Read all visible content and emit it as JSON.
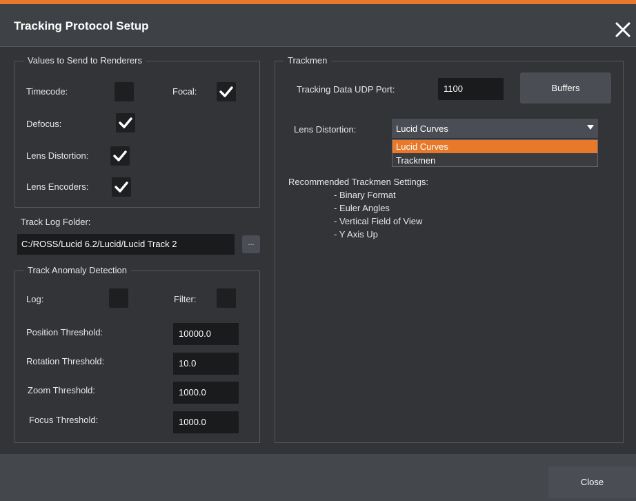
{
  "dialog": {
    "title": "Tracking Protocol Setup",
    "accent_color": "#e8792a",
    "close_icon": "close-icon",
    "close_label": "Close"
  },
  "renderers": {
    "legend": "Values to Send to Renderers",
    "timecode_label": "Timecode:",
    "timecode_checked": false,
    "focal_label": "Focal:",
    "focal_checked": true,
    "defocus_label": "Defocus:",
    "defocus_checked": true,
    "lens_distortion_label": "Lens Distortion:",
    "lens_distortion_checked": true,
    "lens_encoders_label": "Lens Encoders:",
    "lens_encoders_checked": true
  },
  "track_log": {
    "label": "Track Log Folder:",
    "path": "C:/ROSS/Lucid 6.2/Lucid/Lucid Track 2",
    "browse_label": "..."
  },
  "anomaly": {
    "legend": "Track Anomaly Detection",
    "log_label": "Log:",
    "log_checked": false,
    "filter_label": "Filter:",
    "filter_checked": false,
    "position_label": "Position Threshold:",
    "position_value": "10000.0",
    "rotation_label": "Rotation Threshold:",
    "rotation_value": "10.0",
    "zoom_label": "Zoom Threshold:",
    "zoom_value": "1000.0",
    "focus_label": "Focus Threshold:",
    "focus_value": "1000.0"
  },
  "trackmen": {
    "legend": "Trackmen",
    "udp_label": "Tracking Data UDP Port:",
    "udp_value": "1100",
    "buffers_label": "Buffers",
    "lens_distortion_label": "Lens Distortion:",
    "lens_distortion_selected": "Lucid Curves",
    "lens_distortion_options": [
      "Lucid Curves",
      "Trackmen"
    ],
    "highlight_color": "#e8792a",
    "recommended_title": "Recommended Trackmen Settings:",
    "recommended_items": [
      "- Binary Format",
      "- Euler Angles",
      "- Vertical Field of View",
      "- Y Axis Up"
    ]
  }
}
